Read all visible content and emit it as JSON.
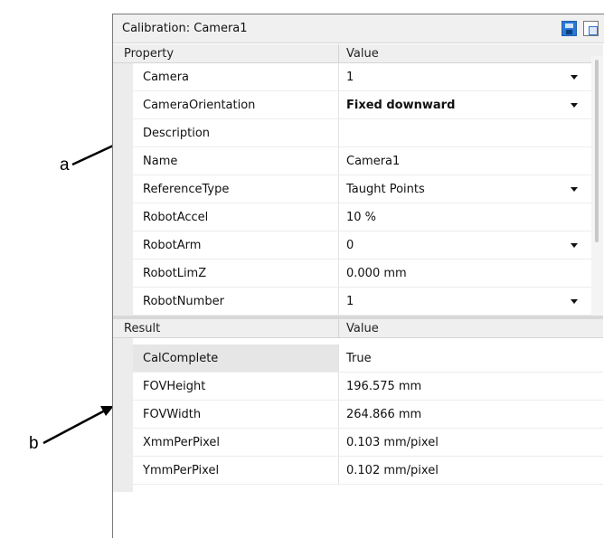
{
  "callouts": {
    "a": "a",
    "b": "b"
  },
  "panel": {
    "title": "Calibration: Camera1",
    "toolbar": {
      "save_icon": "save-icon",
      "copy_icon": "copy-icon"
    }
  },
  "property_grid": {
    "header": {
      "col1": "Property",
      "col2": "Value"
    },
    "rows": [
      {
        "name": "Camera",
        "value": "1",
        "dropdown": true,
        "bold": false
      },
      {
        "name": "CameraOrientation",
        "value": "Fixed downward",
        "dropdown": true,
        "bold": true
      },
      {
        "name": "Description",
        "value": "",
        "dropdown": false,
        "bold": false
      },
      {
        "name": "Name",
        "value": "Camera1",
        "dropdown": false,
        "bold": false
      },
      {
        "name": "ReferenceType",
        "value": "Taught Points",
        "dropdown": true,
        "bold": false
      },
      {
        "name": "RobotAccel",
        "value": "10  %",
        "dropdown": false,
        "bold": false
      },
      {
        "name": "RobotArm",
        "value": "0",
        "dropdown": true,
        "bold": false
      },
      {
        "name": "RobotLimZ",
        "value": "0.000  mm",
        "dropdown": false,
        "bold": false
      },
      {
        "name": "RobotNumber",
        "value": "1",
        "dropdown": true,
        "bold": false
      }
    ]
  },
  "result_grid": {
    "header": {
      "col1": "Result",
      "col2": "Value"
    },
    "rows": [
      {
        "name": "CalComplete",
        "value": "True"
      },
      {
        "name": "FOVHeight",
        "value": "196.575  mm"
      },
      {
        "name": "FOVWidth",
        "value": "264.866  mm"
      },
      {
        "name": "XmmPerPixel",
        "value": "0.103  mm/pixel"
      },
      {
        "name": "YmmPerPixel",
        "value": "0.102  mm/pixel"
      }
    ]
  }
}
